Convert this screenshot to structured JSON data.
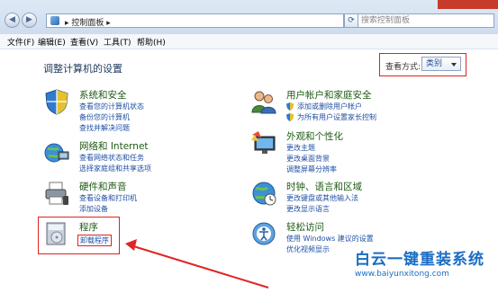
{
  "address": {
    "path_label": "控制面板",
    "chevron": "▸",
    "search_placeholder": "搜索控制面板",
    "refresh_glyph": "⟳"
  },
  "nav": {
    "back": "◀",
    "forward": "▶"
  },
  "menu": [
    "文件(F)",
    "编辑(E)",
    "查看(V)",
    "工具(T)",
    "帮助(H)"
  ],
  "page": {
    "title": "调整计算机的设置",
    "view_label": "查看方式:",
    "view_value": "类别"
  },
  "categories": {
    "system": {
      "title": "系统和安全",
      "links": [
        "查看您的计算机状态",
        "备份您的计算机",
        "查找并解决问题"
      ]
    },
    "network": {
      "title": "网络和 Internet",
      "links": [
        "查看网络状态和任务",
        "选择家庭组和共享选项"
      ]
    },
    "hardware": {
      "title": "硬件和声音",
      "links": [
        "查看设备和打印机",
        "添加设备"
      ]
    },
    "programs": {
      "title": "程序",
      "links": [
        "卸载程序"
      ]
    },
    "users": {
      "title": "用户帐户和家庭安全",
      "links": [
        "添加或删除用户帐户",
        "为所有用户设置家长控制"
      ]
    },
    "appearance": {
      "title": "外观和个性化",
      "links": [
        "更改主题",
        "更改桌面背景",
        "调整屏幕分辨率"
      ]
    },
    "clock": {
      "title": "时钟、语言和区域",
      "links": [
        "更改键盘或其他输入法",
        "更改显示语言"
      ]
    },
    "access": {
      "title": "轻松访问",
      "links": [
        "使用 Windows 建议的设置",
        "优化视频显示"
      ]
    }
  },
  "watermark": {
    "title": "白云一键重装系统",
    "url": "www.baiyunxitong.com"
  },
  "colors": {
    "highlight": "#dd2222",
    "link": "#1f4fa3",
    "title_green": "#1e5a13"
  }
}
